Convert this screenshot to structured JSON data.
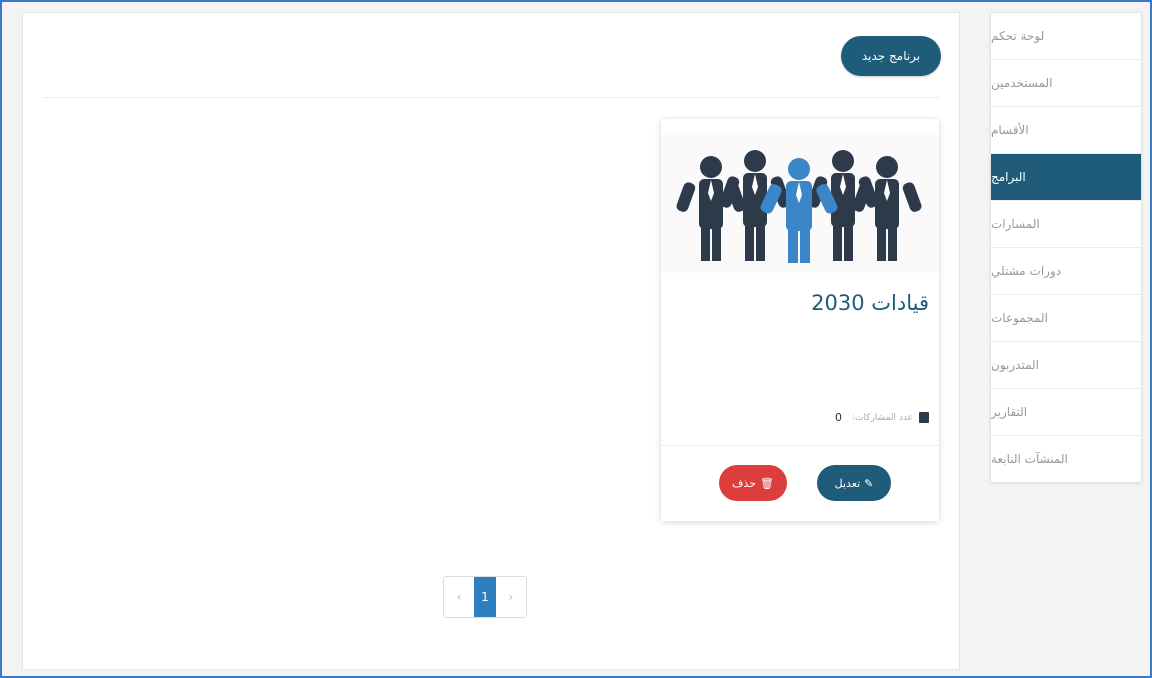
{
  "toolbar": {
    "new_program": "برنامج جديد"
  },
  "program": {
    "title": "قيادات 2030",
    "participants_label": "عدد المشاركات:",
    "participants_count": "0",
    "edit_label": "تعديل",
    "delete_label": "حذف"
  },
  "pagination": {
    "prev": "‹",
    "current": "1",
    "next": "›"
  },
  "sidebar": {
    "items": [
      {
        "label": "لوحة تحكم"
      },
      {
        "label": "المستخدمين"
      },
      {
        "label": "الأقسام"
      },
      {
        "label": "البرامج"
      },
      {
        "label": "المسارات"
      },
      {
        "label": "دورات مشتلي"
      },
      {
        "label": "المجموعات"
      },
      {
        "label": "المتدربون"
      },
      {
        "label": "التقارير"
      },
      {
        "label": "المنشآت التابعة"
      }
    ]
  },
  "colors": {
    "primary": "#1f5c7a",
    "danger": "#dc3d3d",
    "pager_active": "#2f7fc0"
  }
}
